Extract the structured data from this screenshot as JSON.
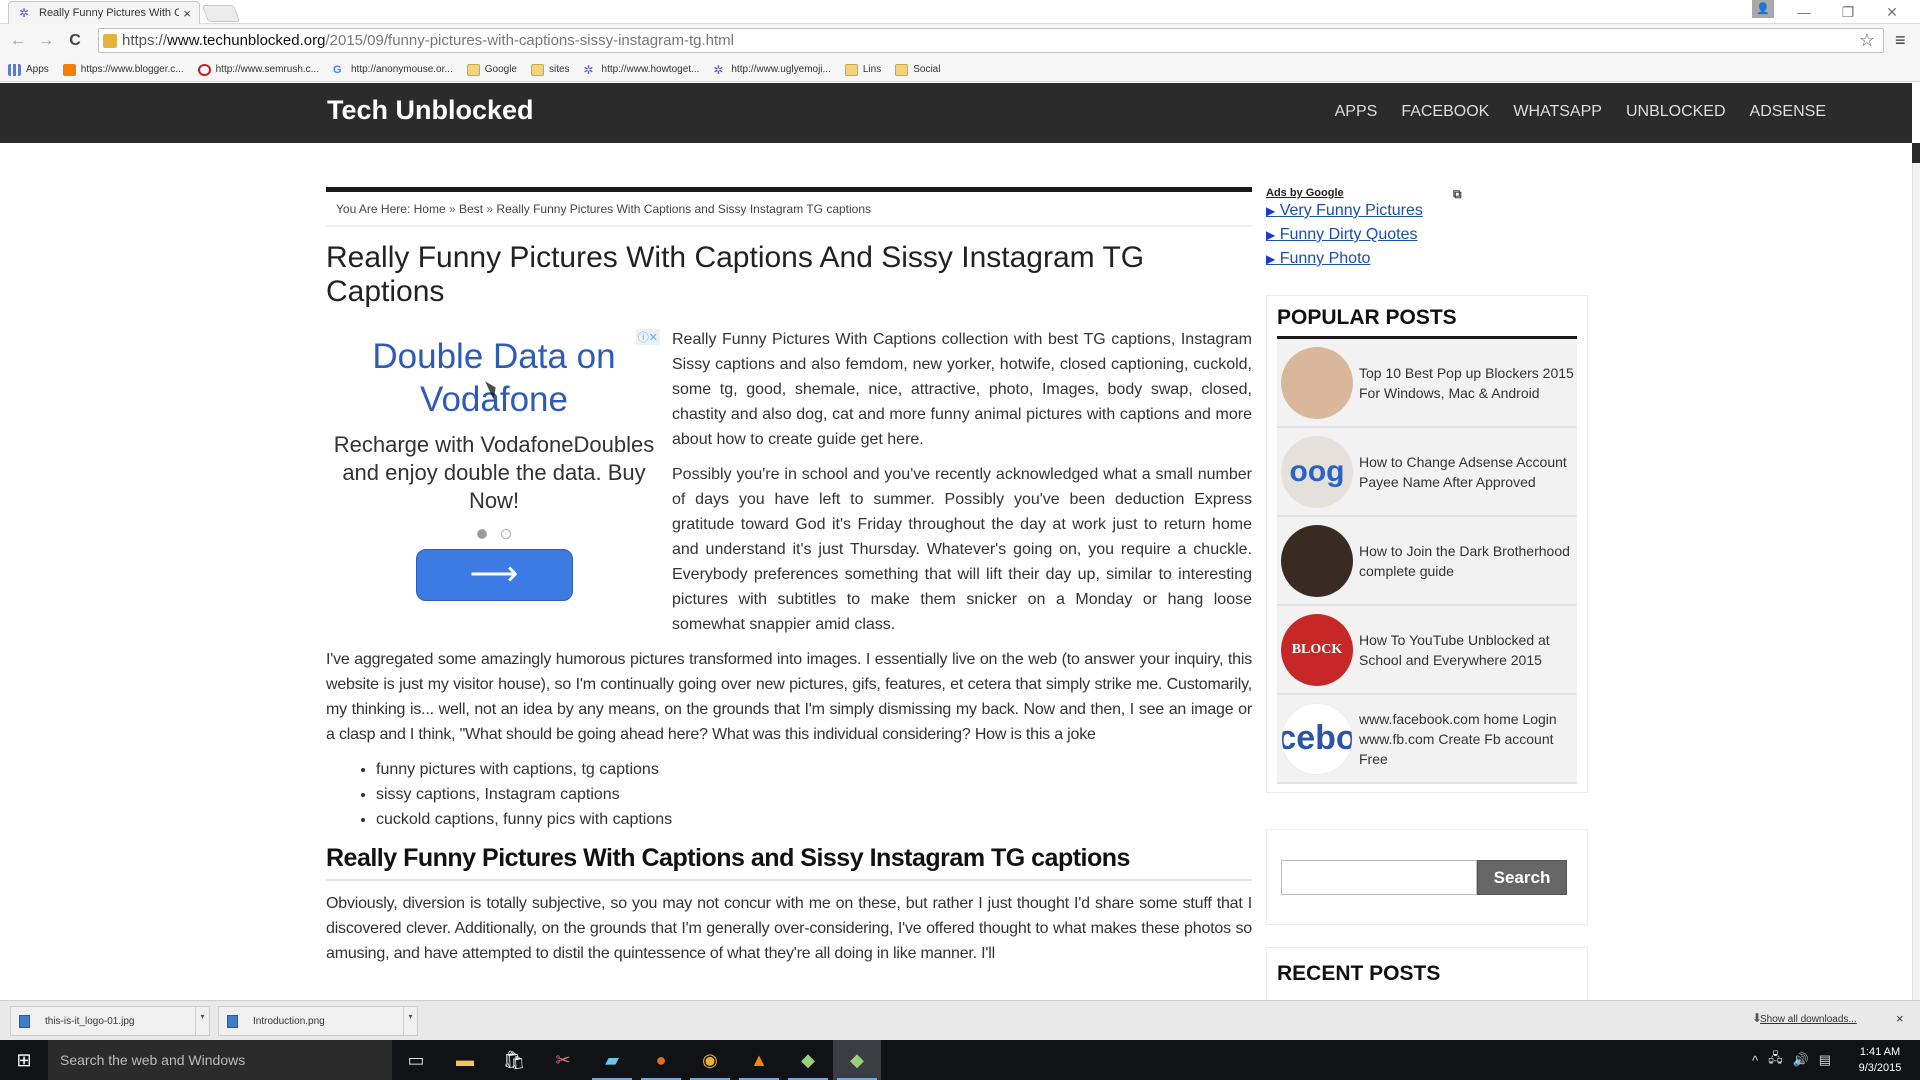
{
  "browser": {
    "tab_title": "Really Funny Pictures With C",
    "tab_close": "×",
    "url": {
      "scheme": "https://",
      "host": "www.techunblocked.org",
      "path": "/2015/09/funny-pictures-with-captions-sissy-instagram-tg.html"
    },
    "window_controls": {
      "minimize": "—",
      "restore": "❐",
      "close": "✕"
    },
    "bookmarks": [
      {
        "label": "Apps",
        "icon": "apps-icon"
      },
      {
        "label": "https://www.blogger.c...",
        "icon": "blogger-icon"
      },
      {
        "label": "http://www.semrush.c...",
        "icon": "opera-icon"
      },
      {
        "label": "http://anonymouse.or...",
        "icon": "google-icon"
      },
      {
        "label": "Google",
        "icon": "folder-icon"
      },
      {
        "label": "sites",
        "icon": "folder-icon"
      },
      {
        "label": "http://www.howtoget...",
        "icon": "site-icon"
      },
      {
        "label": "http://www.uglyemoji...",
        "icon": "site-icon"
      },
      {
        "label": "Lins",
        "icon": "folder-icon"
      },
      {
        "label": "Social",
        "icon": "folder-icon"
      }
    ]
  },
  "site": {
    "title": "Tech Unblocked",
    "nav": [
      "APPS",
      "FACEBOOK",
      "WHATSAPP",
      "UNBLOCKED",
      "ADSENSE"
    ]
  },
  "breadcrumb": {
    "prefix": "You Are Here:",
    "items": [
      "Home",
      "Best",
      "Really Funny Pictures With Captions and Sissy Instagram TG captions"
    ],
    "separator": "»"
  },
  "post": {
    "title": "Really Funny Pictures With Captions And Sissy Instagram TG Captions",
    "paragraphs": [
      "Really Funny Pictures With Captions collection  with best TG captions, Instagram Sissy captions and also femdom, new yorker, hotwife, closed captioning, cuckold, some tg, good, shemale, nice, attractive, photo, Images, body swap, closed, chastity and also dog, cat and more funny animal pictures with captions and more about how to create guide get here.",
      "Possibly you're in school and you've recently acknowledged what a small number of days you have left to summer. Possibly you've been deduction Express gratitude toward God it's Friday throughout the day at work just to return home and understand it's just Thursday. Whatever's going on, you require a chuckle. Everybody preferences something that will lift their day up, similar to interesting pictures with subtitles to make them snicker on a Monday or hang loose somewhat snappier amid class.",
      "I've aggregated some amazingly humorous pictures transformed into images. I essentially live on the web (to answer your inquiry, this website is just my visitor house), so I'm continually going over new pictures, gifs, features, et cetera that simply strike me. Customarily, my thinking is... well, not an idea by any means, on the grounds that I'm simply dismissing my back. Now and then, I see an image or a clasp and I think, \"What should be going ahead here? What was this individual considering? How is this a joke"
    ],
    "bullets": [
      "funny pictures with captions, tg captions",
      "sissy captions, Instagram captions",
      "cuckold captions, funny pics with captions"
    ],
    "subheading": "Really Funny Pictures With Captions and Sissy Instagram TG captions",
    "paragraph_after": "Obviously, diversion is totally subjective, so you may not concur with me on these, but rather I just thought I'd share some stuff that I discovered clever. Additionally, on the grounds that I'm generally over-considering, I've offered thought to what makes these photos so amusing, and have attempted to distil the quintessence of what they're all doing in like manner. I'll"
  },
  "ad": {
    "headline": "Double Data on Vodafone",
    "body": "Recharge with VodafoneDoubles and enjoy double the data. Buy Now!",
    "badge": "ⓘ✕",
    "cta_arrow": "⟶",
    "carousel_active": 1,
    "carousel_total": 2
  },
  "sidebar": {
    "ads_label": "Ads by Google",
    "ad_links": [
      "Very Funny Pictures",
      "Funny Dirty Quotes",
      "Funny Photo"
    ],
    "popular_title": "POPULAR POSTS",
    "popular_posts": [
      {
        "title": "Top 10 Best Pop up Blockers 2015 For Windows, Mac & Android",
        "thumb_text": "",
        "thumb_bg": "#d9b79a"
      },
      {
        "title": "How to Change Adsense Account Payee Name After Approved",
        "thumb_text": "oog",
        "thumb_bg": "#e6e0da"
      },
      {
        "title": "How to Join the Dark Brotherhood complete guide",
        "thumb_text": "",
        "thumb_bg": "#3a2b22"
      },
      {
        "title": "How To YouTube Unblocked at School and Everywhere 2015",
        "thumb_text": "BLOCK",
        "thumb_bg": "#c62828"
      },
      {
        "title": "www.facebook.com home Login www.fb.com Create Fb account Free",
        "thumb_text": "cebo",
        "thumb_bg": "#ffffff"
      }
    ],
    "search_button": "Search",
    "search_value": "",
    "recent_title": "RECENT POSTS"
  },
  "downloads": {
    "items": [
      "this-is-it_logo-01.jpg",
      "Introduction.png"
    ],
    "show_all": "Show all downloads...",
    "close": "×"
  },
  "taskbar": {
    "search_placeholder": "Search the web and Windows",
    "time": "1:41 AM",
    "date": "9/3/2015"
  }
}
